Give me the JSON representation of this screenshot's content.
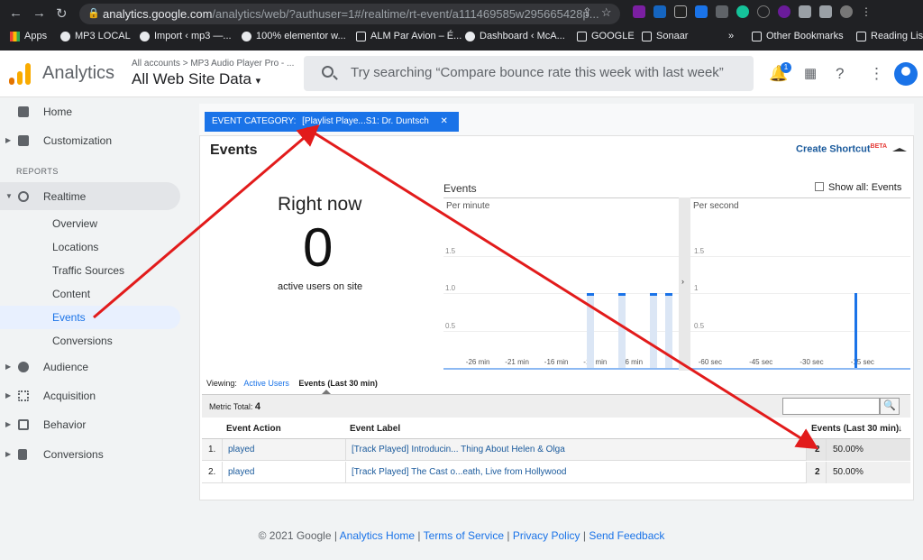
{
  "browser": {
    "url_domain": "analytics.google.com",
    "url_path": "/analytics/web/?authuser=1#/realtime/rt-event/a111469585w295665428p...",
    "bookmarks": [
      "Apps",
      "MP3 LOCAL",
      "Import ‹ mp3 —...",
      "100% elementor w...",
      "ALM Par Avion – É...",
      "Dashboard ‹ McA...",
      "GOOGLE",
      "Sonaar"
    ],
    "other_bookmarks": "Other Bookmarks",
    "reading_list": "Reading List"
  },
  "header": {
    "app_name": "Analytics",
    "breadcrumb": "All accounts > MP3 Audio Player Pro - ...",
    "property": "All Web Site Data",
    "search_placeholder": "Try searching “Compare bounce rate this week with last week”",
    "notification_count": "1"
  },
  "sidebar": {
    "home": "Home",
    "customization": "Customization",
    "reports_header": "REPORTS",
    "realtime": "Realtime",
    "realtime_items": [
      "Overview",
      "Locations",
      "Traffic Sources",
      "Content",
      "Events",
      "Conversions"
    ],
    "audience": "Audience",
    "acquisition": "Acquisition",
    "behavior": "Behavior",
    "conversions": "Conversions"
  },
  "filter": {
    "label": "EVENT CATEGORY:",
    "value": "[Playlist Playe...S1: Dr. Duntsch",
    "close": "✕"
  },
  "page": {
    "title": "Events",
    "create_shortcut": "Create Shortcut",
    "beta": "BETA"
  },
  "rightnow": {
    "label": "Right now",
    "value": "0",
    "caption": "active users on site"
  },
  "events_chart": {
    "title": "Events",
    "show_all": "Show all: Events",
    "per_minute_title": "Per minute",
    "per_second_title": "Per second"
  },
  "chart_data": [
    {
      "type": "bar",
      "title": "Per minute",
      "x_tick_labels": [
        "-26 min",
        "-21 min",
        "-16 min",
        "-11 min",
        "-6 min"
      ],
      "y_tick_labels": [
        "1.5",
        "1.0",
        "0.5"
      ],
      "ylim": [
        0,
        2
      ],
      "bars": [
        {
          "minutes_ago": 11,
          "value": 1
        },
        {
          "minutes_ago": 7,
          "value": 1
        },
        {
          "minutes_ago": 3,
          "value": 1
        },
        {
          "minutes_ago": 1,
          "value": 1
        }
      ]
    },
    {
      "type": "bar",
      "title": "Per second",
      "x_tick_labels": [
        "-60 sec",
        "-45 sec",
        "-30 sec",
        "-15 sec"
      ],
      "y_tick_labels": [
        "1.5",
        "1",
        "0.5"
      ],
      "ylim": [
        0,
        2
      ],
      "bars": [
        {
          "seconds_ago": 15,
          "value": 1
        }
      ]
    }
  ],
  "viewing": {
    "label": "Viewing:",
    "tab_active_users": "Active Users",
    "tab_events": "Events (Last 30 min)"
  },
  "metric": {
    "label": "Metric Total:",
    "value": "4",
    "search_button": "🔍"
  },
  "table": {
    "columns": [
      "Event Action",
      "Event Label",
      "Events (Last 30 min)"
    ],
    "sort_icon": "↓",
    "rows": [
      {
        "index": "1.",
        "action": "played",
        "label": "[Track Played] Introducin... Thing About Helen & Olga",
        "count": "2",
        "percent": "50.00%"
      },
      {
        "index": "2.",
        "action": "played",
        "label": "[Track Played] The Cast o...eath, Live from Hollywood",
        "count": "2",
        "percent": "50.00%"
      }
    ]
  },
  "footer": {
    "copyright": "© 2021 Google",
    "links": [
      "Analytics Home",
      "Terms of Service",
      "Privacy Policy",
      "Send Feedback"
    ],
    "sep": "|"
  },
  "annotation_color": "#e21b1b",
  "accent_color": "#1a73e8"
}
